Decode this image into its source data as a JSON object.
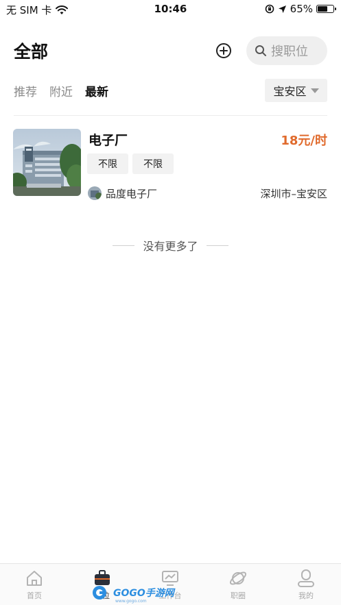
{
  "status_bar": {
    "carrier": "无 SIM 卡",
    "time": "10:46",
    "battery_percent": "65%",
    "battery_level": 0.65,
    "icons": [
      "wifi-icon",
      "rotation-lock-icon",
      "location-arrow-icon",
      "battery-icon"
    ]
  },
  "header": {
    "title": "全部",
    "add_icon": "plus-circle-icon",
    "search_placeholder": "搜职位"
  },
  "tabs": [
    {
      "label": "推荐",
      "active": false
    },
    {
      "label": "附近",
      "active": false
    },
    {
      "label": "最新",
      "active": true
    }
  ],
  "district_filter": {
    "label": "宝安区"
  },
  "jobs": [
    {
      "title": "电子厂",
      "salary": "18元/时",
      "tags": [
        "不限",
        "不限"
      ],
      "company": "品度电子厂",
      "location": "深圳市–宝安区"
    }
  ],
  "list_end_text": "没有更多了",
  "bottom_nav": [
    {
      "label": "首页",
      "icon": "home-icon",
      "active": false
    },
    {
      "label": "职位",
      "icon": "briefcase-icon",
      "active": true
    },
    {
      "label": "工作台",
      "icon": "monitor-chart-icon",
      "active": false
    },
    {
      "label": "职圈",
      "icon": "planet-icon",
      "active": false
    },
    {
      "label": "我的",
      "icon": "user-icon",
      "active": false
    }
  ],
  "watermark": {
    "text": "GOGO手游网",
    "sub": "www.gogo.com"
  },
  "colors": {
    "accent_salary": "#e06a2c",
    "active_nav": "#333333",
    "inactive_nav": "#a8a8a8"
  }
}
